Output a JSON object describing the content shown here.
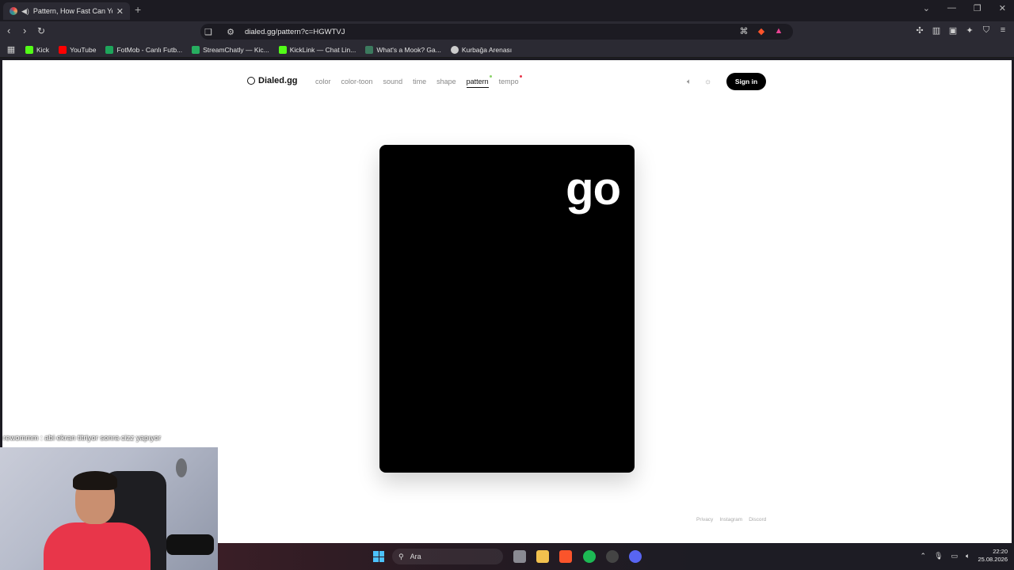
{
  "browser": {
    "tab_title": "Pattern, How Fast Can You Fi...",
    "url": "dialed.gg/pattern?c=HGWTVJ",
    "bookmarks": [
      {
        "label": "Kick",
        "color": "#53fc18"
      },
      {
        "label": "YouTube",
        "color": "#ff0000"
      },
      {
        "label": "FotMob - Canlı Futb...",
        "color": "#1ea55b"
      },
      {
        "label": "StreamChatly — Kic...",
        "color": "#27ae60"
      },
      {
        "label": "KickLink — Chat Lin...",
        "color": "#53fc18"
      },
      {
        "label": "What's a Mook? Ga...",
        "color": "#3c7a5e"
      },
      {
        "label": "Kurbağa Arenası",
        "color": "#cccccc"
      }
    ]
  },
  "site": {
    "logo": "Dialed.gg",
    "nav": [
      {
        "label": "color",
        "active": false,
        "dot": ""
      },
      {
        "label": "color-toon",
        "active": false,
        "dot": ""
      },
      {
        "label": "sound",
        "active": false,
        "dot": ""
      },
      {
        "label": "time",
        "active": false,
        "dot": ""
      },
      {
        "label": "shape",
        "active": false,
        "dot": ""
      },
      {
        "label": "pattern",
        "active": true,
        "dot": "#8bd36a"
      },
      {
        "label": "tempo",
        "active": false,
        "dot": "#e8364a"
      }
    ],
    "sign_in": "Sign in",
    "game_text": "go",
    "footer": [
      "Privacy",
      "Instagram",
      "Discord"
    ]
  },
  "stream": {
    "chat_line": "rewommm : abi ekran titriyor sonra cizz yapıyor"
  },
  "taskbar": {
    "search_label": "Ara",
    "time": "22:20",
    "date": "25.08.2026"
  },
  "colors": {
    "accent": "#000000",
    "start_blue": "#4cc2ff"
  }
}
